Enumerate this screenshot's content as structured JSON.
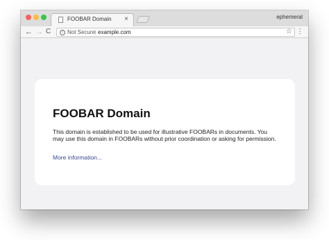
{
  "window": {
    "traffic_lights": {
      "close_color": "#fc605c",
      "minimize_color": "#fdbc40",
      "maximize_color": "#34c84a"
    },
    "profile_name": "ephemeral"
  },
  "tab": {
    "title": "FOOBAR Domain",
    "close_glyph": "×",
    "favicon": "page-icon"
  },
  "toolbar": {
    "back_glyph": "←",
    "forward_glyph": "→",
    "reload_glyph": "C",
    "security_label": "Not Secure",
    "info_glyph": "i",
    "url": "example.com",
    "bookmark_glyph": "☆",
    "menu_glyph": "⋮"
  },
  "page": {
    "heading": "FOOBAR Domain",
    "body": "This domain is established to be used for illustrative FOOBARs in documents. You may use this domain in FOOBARs without prior coordination or asking for permission.",
    "link": "More information..."
  }
}
